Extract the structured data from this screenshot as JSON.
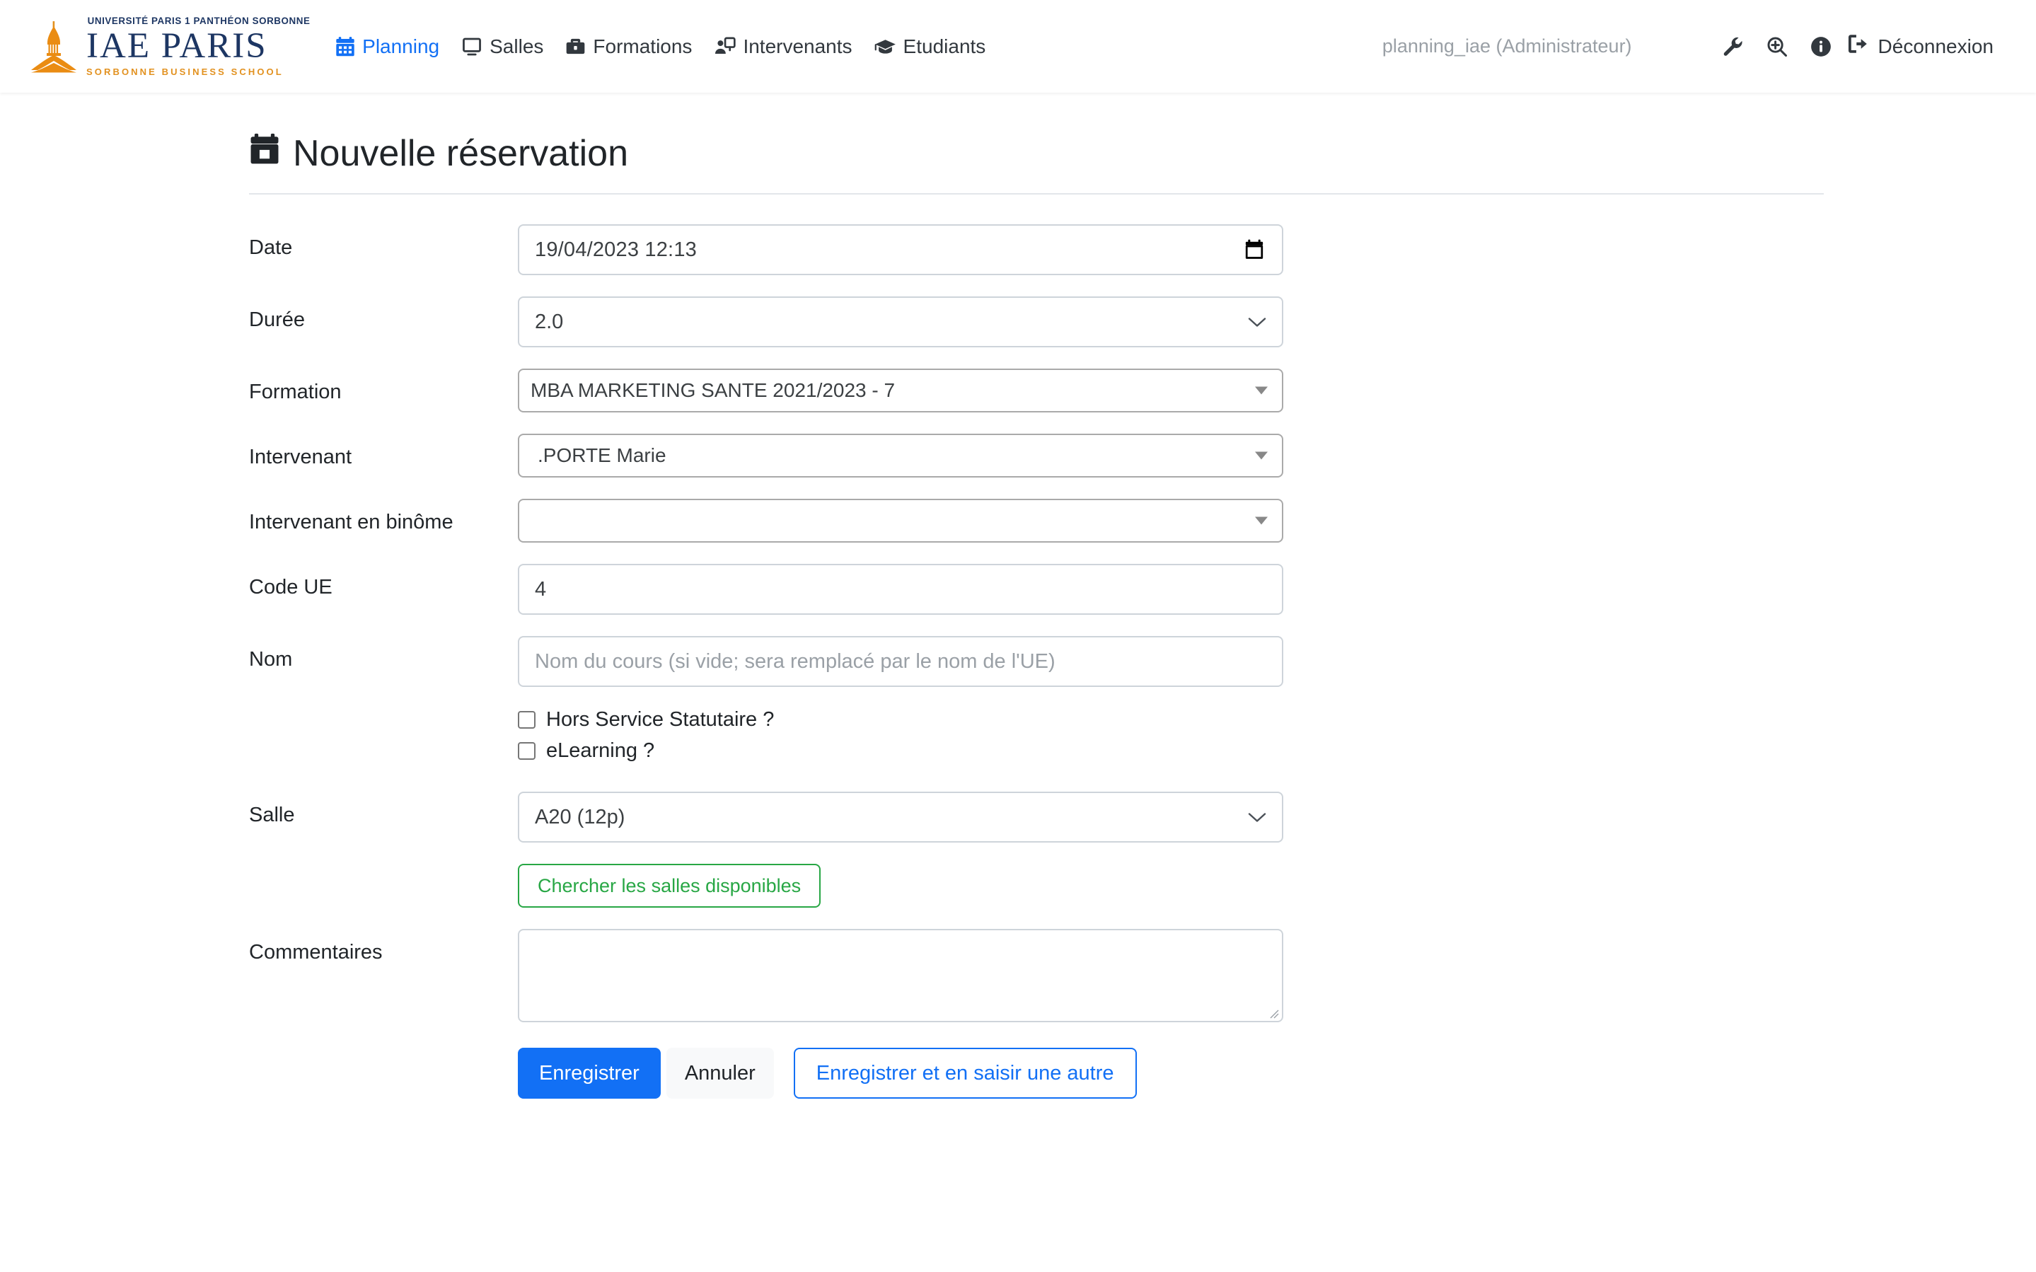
{
  "brand": {
    "top_line": "UNIVERSITÉ PARIS 1 PANTHÉON SORBONNE",
    "main": "IAE PARIS",
    "sub_line": "SORBONNE BUSINESS SCHOOL"
  },
  "nav": {
    "items": [
      {
        "label": "Planning",
        "icon": "calendar-icon",
        "active": true
      },
      {
        "label": "Salles",
        "icon": "screen-icon",
        "active": false
      },
      {
        "label": "Formations",
        "icon": "briefcase-icon",
        "active": false
      },
      {
        "label": "Intervenants",
        "icon": "presenter-icon",
        "active": false
      },
      {
        "label": "Etudiants",
        "icon": "graduation-cap-icon",
        "active": false
      }
    ],
    "user": "planning_iae (Administrateur)",
    "tools": [
      {
        "name": "wrench-icon"
      },
      {
        "name": "zoom-in-icon"
      },
      {
        "name": "info-icon"
      }
    ],
    "logout_label": "Déconnexion",
    "logout_icon": "sign-out-icon",
    "active_color": "#1270f5"
  },
  "page": {
    "title": "Nouvelle réservation",
    "title_icon": "calendar-icon"
  },
  "form": {
    "date": {
      "label": "Date",
      "value": "19/04/2023 12:13",
      "picker_icon": "calendar-picker-icon"
    },
    "duree": {
      "label": "Durée",
      "value": "2.0"
    },
    "formation": {
      "label": "Formation",
      "value": "MBA MARKETING SANTE 2021/2023 - 7"
    },
    "intervenant": {
      "label": "Intervenant",
      "value": ".PORTE Marie"
    },
    "intervenant_binome": {
      "label": "Intervenant en binôme",
      "value": ""
    },
    "code_ue": {
      "label": "Code UE",
      "value": "4"
    },
    "nom": {
      "label": "Nom",
      "value": "",
      "placeholder": "Nom du cours (si vide; sera remplacé par le nom de l'UE)"
    },
    "checkboxes": [
      {
        "label": "Hors Service Statutaire ?",
        "checked": false
      },
      {
        "label": "eLearning ?",
        "checked": false
      }
    ],
    "salle": {
      "label": "Salle",
      "value": "A20 (12p)"
    },
    "search_rooms_button": "Chercher les salles disponibles",
    "commentaires": {
      "label": "Commentaires",
      "value": ""
    },
    "actions": {
      "save": "Enregistrer",
      "cancel": "Annuler",
      "save_and_new": "Enregistrer et en saisir une autre"
    }
  },
  "colors": {
    "primary": "#1270f5",
    "success": "#28a745",
    "brand_navy": "#1d3663",
    "brand_orange": "#e2911f"
  }
}
